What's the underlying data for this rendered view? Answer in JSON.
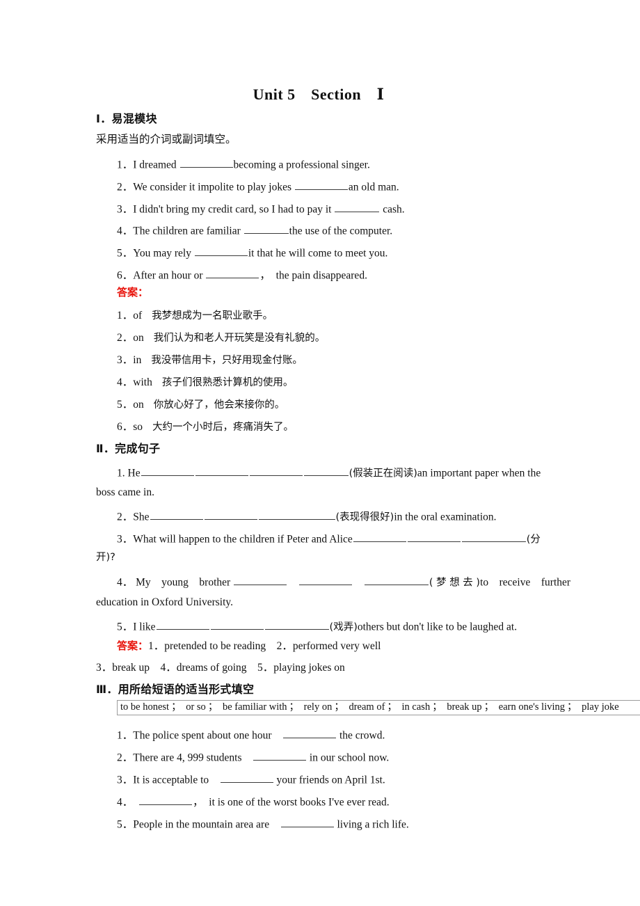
{
  "title": "Unit 5　Section　Ⅰ",
  "section1": {
    "heading": "Ⅰ．易混模块",
    "instruction": "采用适当的介词或副词填空。",
    "questions": [
      {
        "no": "1．",
        "pre": "I dreamed ",
        "post": "becoming a professional singer."
      },
      {
        "no": "2．",
        "pre": "We consider it impolite to play jokes ",
        "post": "an old man."
      },
      {
        "no": "3．",
        "pre": "I didn't bring my credit card, so I had to pay it ",
        "post": " cash."
      },
      {
        "no": "4．",
        "pre": "The children are familiar ",
        "post": "the use of the computer."
      },
      {
        "no": "5．",
        "pre": "You may rely ",
        "post": "it that he will come to meet you."
      },
      {
        "no": "6．",
        "pre": "After an hour or ",
        "post": "，　the pain disappeared."
      }
    ],
    "answer_label": "答案：",
    "answers": [
      {
        "no": "1．",
        "word": "of",
        "cn": "我梦想成为一名职业歌手。"
      },
      {
        "no": "2．",
        "word": "on",
        "cn": "我们认为和老人开玩笑是没有礼貌的。"
      },
      {
        "no": "3．",
        "word": "in",
        "cn": "我没带信用卡，只好用现金付账。"
      },
      {
        "no": "4．",
        "word": "with",
        "cn": "孩子们很熟悉计算机的使用。"
      },
      {
        "no": "5．",
        "word": "on",
        "cn": "你放心好了，他会来接你的。"
      },
      {
        "no": "6．",
        "word": "so",
        "cn": "大约一个小时后，疼痛消失了。"
      }
    ]
  },
  "section2": {
    "heading": "Ⅱ．完成句子",
    "q1_no": "1.",
    "q1_pre": "He",
    "q1_hint": "(假装正在阅读)",
    "q1_post": "an important paper when the",
    "q1_cont": "boss came in.",
    "q2_no": "2．",
    "q2_pre": "She",
    "q2_hint": "(表现得很好)",
    "q2_post": "in the oral examination.",
    "q3_no": "3．",
    "q3_pre": "What will happen to the children if Peter and Alice",
    "q3_hint": "(分",
    "q3_cont": "开)?",
    "q4_no": "4．",
    "q4_pre": "My　young　brother",
    "q4_hint": "( 梦 想 去 )",
    "q4_post": "to　receive　further",
    "q4_cont": "education in Oxford University.",
    "q5_no": "5．",
    "q5_pre": "I like",
    "q5_hint": "(戏弄)",
    "q5_post": "others but don't like to be laughed at.",
    "answer_label": "答案：",
    "answer_line1": "1．pretended to be reading　2．performed very well",
    "answer_line2": "3．break up　4．dreams of going　5．playing jokes on"
  },
  "section3": {
    "heading": "Ⅲ．用所给短语的适当形式填空",
    "phrases": [
      "to be honest",
      "or so",
      "be familiar with",
      "rely on",
      "dream of",
      "in cash",
      "break up",
      "earn one's living",
      "play joke"
    ],
    "separator": "；",
    "questions": [
      {
        "no": "1．",
        "pre": "The police spent about one hour　",
        "post": " the crowd."
      },
      {
        "no": "2．",
        "pre": "There are 4, 999 students　",
        "post": " in our school now."
      },
      {
        "no": "3．",
        "pre": "It is acceptable to　",
        "post": " your friends on April 1st."
      },
      {
        "no": "4．",
        "pre": "　",
        "post": "，　it is one of the worst books I've ever read."
      },
      {
        "no": "5．",
        "pre": "People in the mountain area are　",
        "post": " living a rich life."
      }
    ]
  }
}
